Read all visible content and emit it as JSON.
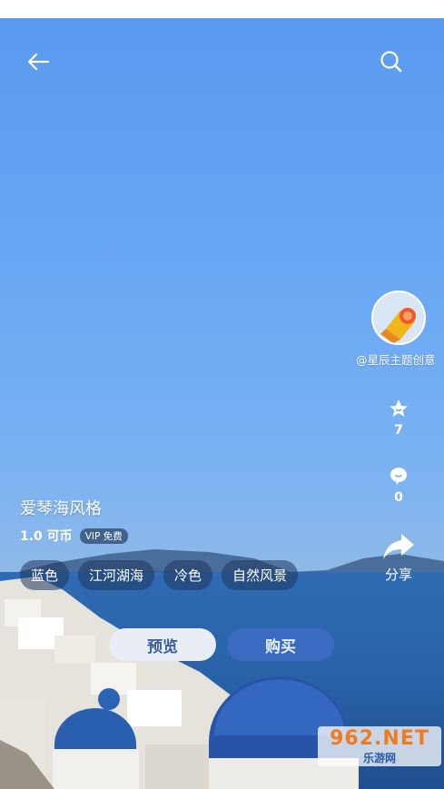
{
  "theme": {
    "title": "爱琴海风格",
    "price": "1.0 可币",
    "vip_badge": "VIP 免费",
    "tags": [
      "蓝色",
      "江河湖海",
      "冷色",
      "自然风景"
    ]
  },
  "author": {
    "name": "@星辰主题创意"
  },
  "actions": {
    "like_count": "7",
    "comment_count": "0",
    "share_label": "分享"
  },
  "buttons": {
    "preview": "预览",
    "buy": "购买"
  },
  "icons": {
    "back": "arrow-left-icon",
    "search": "search-icon",
    "like": "star-face-icon",
    "comment": "chat-bubble-icon",
    "share": "share-arrow-icon"
  },
  "watermark": {
    "main": "962.NET",
    "sub": "乐游网"
  },
  "colors": {
    "buy_button": "#3a6bc0",
    "preview_button": "#e9eef6",
    "sky": "#6aa8f4"
  }
}
